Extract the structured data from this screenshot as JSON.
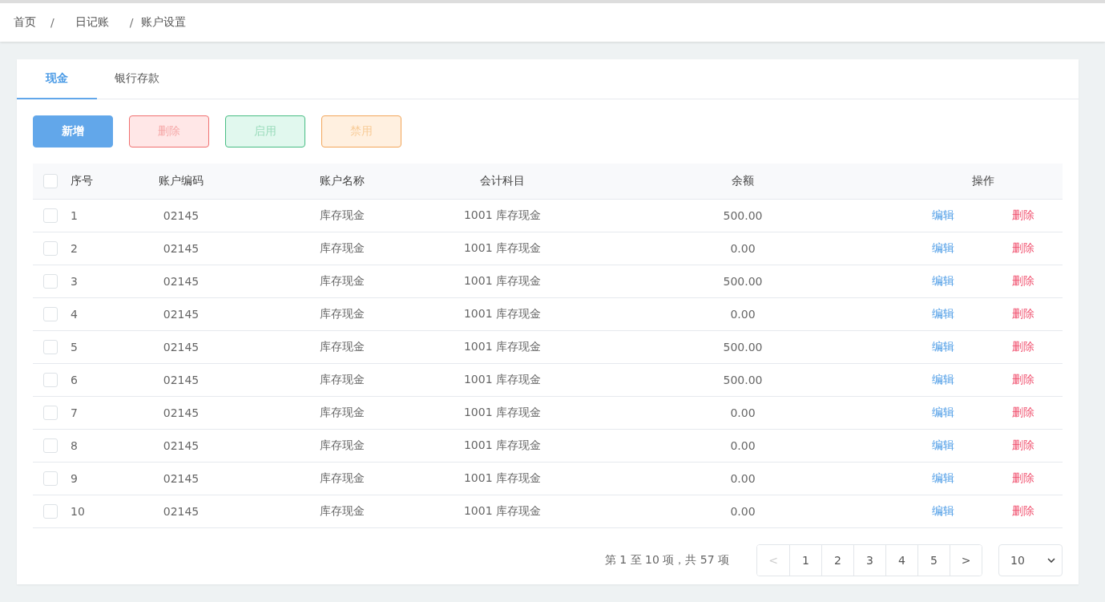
{
  "breadcrumb": [
    {
      "label": "首页"
    },
    {
      "separator": "/",
      "label": "日记账"
    },
    {
      "separator": "/",
      "label": "账户设置"
    }
  ],
  "tabs": [
    {
      "label": "现金",
      "selected": true
    },
    {
      "label": "银行存款",
      "selected": false
    }
  ],
  "actions": [
    {
      "label": "新增",
      "kind": "primary",
      "disabled": false
    },
    {
      "label": "删除",
      "kind": "danger",
      "disabled": true
    },
    {
      "label": "启用",
      "kind": "success",
      "disabled": true
    },
    {
      "label": "禁用",
      "kind": "warning",
      "disabled": true
    }
  ],
  "table": {
    "select_all_checked": false,
    "columns": [
      "序号",
      "账户编码",
      "账户名称",
      "会计科目",
      "余额",
      "操作"
    ],
    "rows": [
      {
        "checked": false,
        "no": "1",
        "code": "02145",
        "name": "库存现金",
        "subject": "1001 库存现金",
        "balance": "500.00",
        "edit": "编辑",
        "delete": "删除"
      },
      {
        "checked": false,
        "no": "2",
        "code": "02145",
        "name": "库存现金",
        "subject": "1001 库存现金",
        "balance": "0.00",
        "edit": "编辑",
        "delete": "删除"
      },
      {
        "checked": false,
        "no": "3",
        "code": "02145",
        "name": "库存现金",
        "subject": "1001 库存现金",
        "balance": "500.00",
        "edit": "编辑",
        "delete": "删除"
      },
      {
        "checked": false,
        "no": "4",
        "code": "02145",
        "name": "库存现金",
        "subject": "1001 库存现金",
        "balance": "0.00",
        "edit": "编辑",
        "delete": "删除"
      },
      {
        "checked": false,
        "no": "5",
        "code": "02145",
        "name": "库存现金",
        "subject": "1001 库存现金",
        "balance": "500.00",
        "edit": "编辑",
        "delete": "删除"
      },
      {
        "checked": false,
        "no": "6",
        "code": "02145",
        "name": "库存现金",
        "subject": "1001 库存现金",
        "balance": "500.00",
        "edit": "编辑",
        "delete": "删除"
      },
      {
        "checked": false,
        "no": "7",
        "code": "02145",
        "name": "库存现金",
        "subject": "1001 库存现金",
        "balance": "0.00",
        "edit": "编辑",
        "delete": "删除"
      },
      {
        "checked": false,
        "no": "8",
        "code": "02145",
        "name": "库存现金",
        "subject": "1001 库存现金",
        "balance": "0.00",
        "edit": "编辑",
        "delete": "删除"
      },
      {
        "checked": false,
        "no": "9",
        "code": "02145",
        "name": "库存现金",
        "subject": "1001 库存现金",
        "balance": "0.00",
        "edit": "编辑",
        "delete": "删除"
      },
      {
        "checked": false,
        "no": "10",
        "code": "02145",
        "name": "库存现金",
        "subject": "1001 库存现金",
        "balance": "0.00",
        "edit": "编辑",
        "delete": "删除"
      }
    ]
  },
  "pagination": {
    "summary": "第 1 至 10 项，共 57 项",
    "prev": {
      "label": "<",
      "disabled": true
    },
    "pages": [
      "1",
      "2",
      "3",
      "4",
      "5"
    ],
    "next": {
      "label": ">",
      "disabled": false
    },
    "page_size": "10"
  }
}
